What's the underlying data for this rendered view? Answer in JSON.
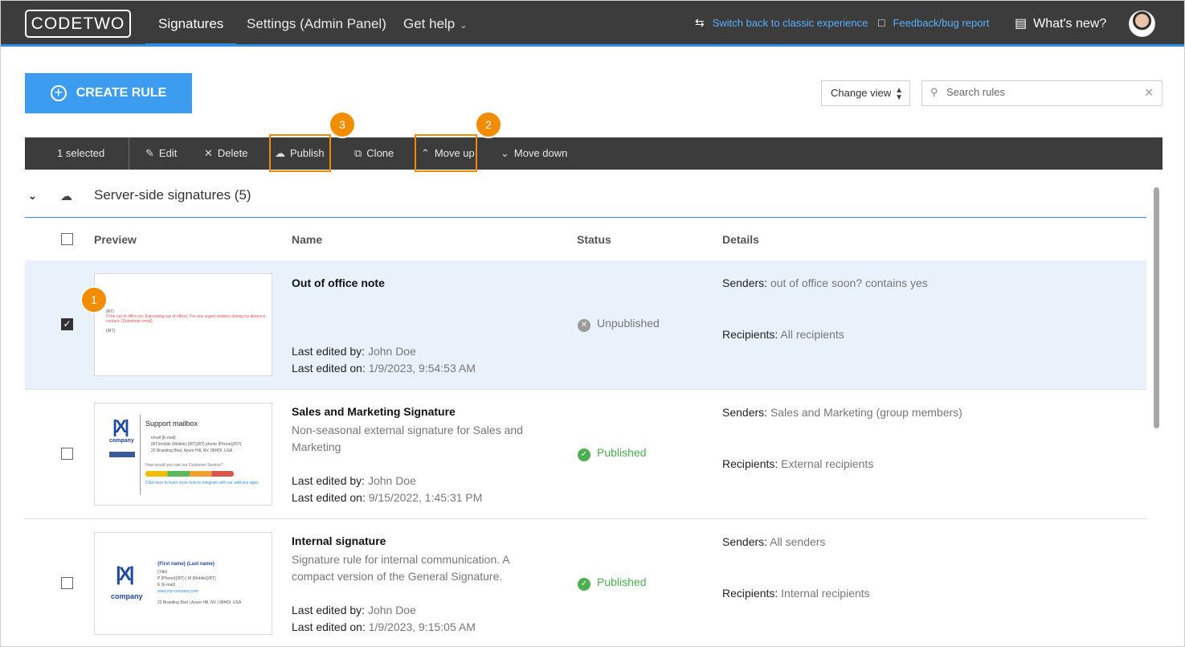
{
  "topbar": {
    "logo": "CODETWO",
    "tabs": [
      {
        "label": "Signatures",
        "active": true
      },
      {
        "label": "Settings (Admin Panel)",
        "active": false
      },
      {
        "label": "Get help",
        "active": false
      }
    ],
    "switch_link": "Switch back to classic experience",
    "feedback_link": "Feedback/bug report",
    "whats_new": "What's new?"
  },
  "toolbar": {
    "create_rule": "CREATE RULE",
    "change_view": "Change view",
    "search_placeholder": "Search rules"
  },
  "actionbar": {
    "selected": "1 selected",
    "edit": "Edit",
    "delete": "Delete",
    "publish": "Publish",
    "clone": "Clone",
    "move_up": "Move up",
    "move_down": "Move down"
  },
  "badges": {
    "one": "1",
    "two": "2",
    "three": "3"
  },
  "group": {
    "title": "Server-side signatures (5)"
  },
  "columns": {
    "preview": "Preview",
    "name": "Name",
    "status": "Status",
    "details": "Details"
  },
  "labels": {
    "last_edited_by": "Last edited by:",
    "last_edited_on": "Last edited on:",
    "senders": "Senders:",
    "recipients": "Recipients:"
  },
  "rows": [
    {
      "name": "Out of office note",
      "description": "",
      "edited_by": "John Doe",
      "edited_on": "1/9/2023, 9:54:53 AM",
      "status": "Unpublished",
      "senders": "out of office soon? contains yes",
      "recipients": "All recipients",
      "checked": true,
      "preview": {
        "line1": "{RT}",
        "line2": "I'll be out of office on: {Upcoming out of office}. For any urgent matters during my absence, contact: {Substitute email}",
        "line3": "{/RT}"
      }
    },
    {
      "name": "Sales and Marketing Signature",
      "description": "Non-seasonal external signature for Sales and Marketing",
      "edited_by": "John Doe",
      "edited_on": "9/15/2022, 1:45:31 PM",
      "status": "Published",
      "senders": "Sales and Marketing (group members)",
      "recipients": "External recipients",
      "checked": false,
      "preview": {
        "title": "Support mailbox",
        "company": "company",
        "l1": "email {E-mail}",
        "l2": "{RT}mobile {Mobile} {/RT}{RT} phone {Phone}{/RT}",
        "l3": "22 Branding Blvd, Azure Hill, NV, 88HDI, USA",
        "survey": "How would you rate our Customer Service?",
        "link": "Click here to learn more how to integrate with our add-ons apps"
      }
    },
    {
      "name": "Internal signature",
      "description": "Signature rule for internal communication. A compact version of the General Signature.",
      "edited_by": "John Doe",
      "edited_on": "1/9/2023, 9:15:05 AM",
      "status": "Published",
      "senders": "All senders",
      "recipients": "Internal recipients",
      "checked": false,
      "preview": {
        "name": "{First name} {Last name}",
        "title": "{Title}",
        "l1": "P {Phone}{/RT} | M {Mobile}{/RT}",
        "l2": "E {E-mail}",
        "l3": "www.my-company.com",
        "l4": "22 Branding Blvd | Azure Hill, NV | 88HDI, USA",
        "company": "company"
      }
    }
  ]
}
